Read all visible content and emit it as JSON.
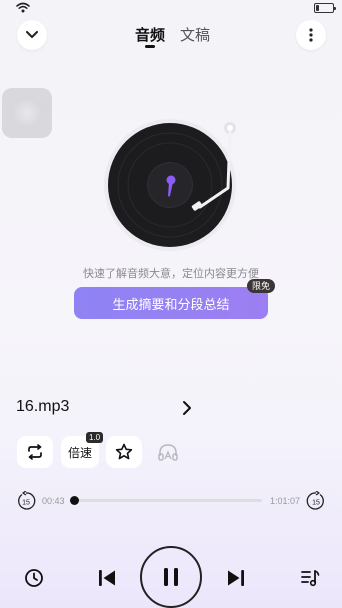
{
  "tabs": [
    {
      "label": "音频",
      "active": true
    },
    {
      "label": "文稿",
      "active": false
    }
  ],
  "hint": "快速了解音频大意，定位内容更方便",
  "summary_button": {
    "label": "生成摘要和分段总结",
    "badge": "限免"
  },
  "track": {
    "filename": "16.mp3",
    "current_time": "00:43",
    "total_time": "1:01:07",
    "progress": 0.012
  },
  "controls": {
    "speed_label": "倍速",
    "speed_value": "1.0",
    "seek_back_seconds": "15",
    "seek_forward_seconds": "15"
  },
  "colors": {
    "accent": "#8f83f4",
    "record_note": "#8b5cf6",
    "badge_bg": "#3b3536"
  },
  "icons": [
    "wifi-icon",
    "battery-icon",
    "chevron-down-icon",
    "more-vertical-icon",
    "chevron-right-icon",
    "loop-icon",
    "star-icon",
    "headphone-icon",
    "rewind-15-icon",
    "forward-15-icon",
    "timer-icon",
    "previous-icon",
    "pause-icon",
    "next-icon",
    "playlist-icon"
  ]
}
